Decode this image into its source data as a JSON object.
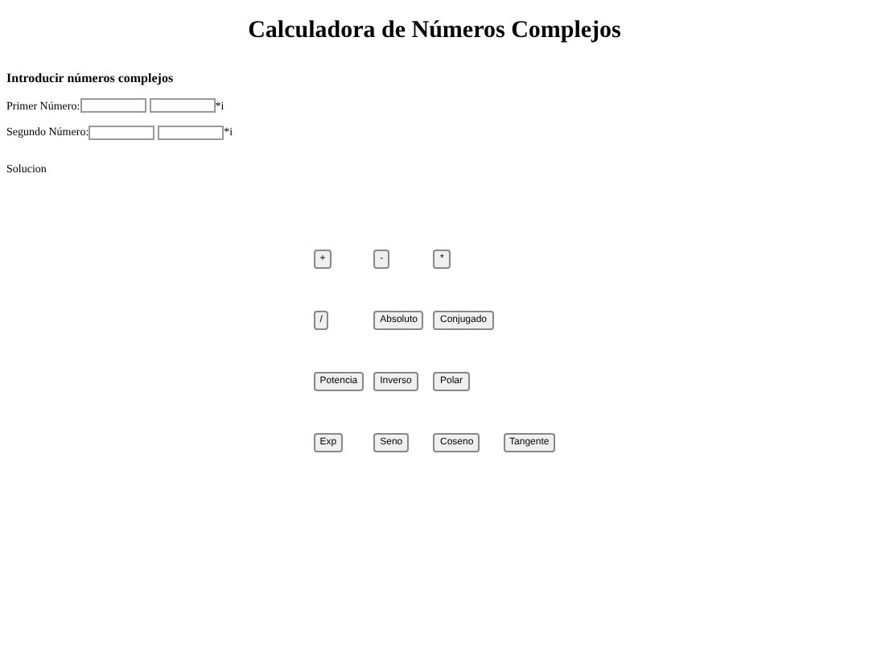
{
  "title": "Calculadora de Números Complejos",
  "heading": "Introducir números complejos",
  "inputs": [
    {
      "label": "Primer Número:",
      "suffix": "*i"
    },
    {
      "label": "Segundo Número:",
      "suffix": "*i"
    }
  ],
  "solution_label": "Solucion",
  "button_rows": [
    [
      "+",
      "-",
      "*"
    ],
    [
      "/",
      "Absoluto",
      "Conjugado"
    ],
    [
      "Potencia",
      "Inverso",
      "Polar"
    ],
    [
      "Exp",
      "Seno",
      "Coseno",
      "Tangente"
    ]
  ]
}
